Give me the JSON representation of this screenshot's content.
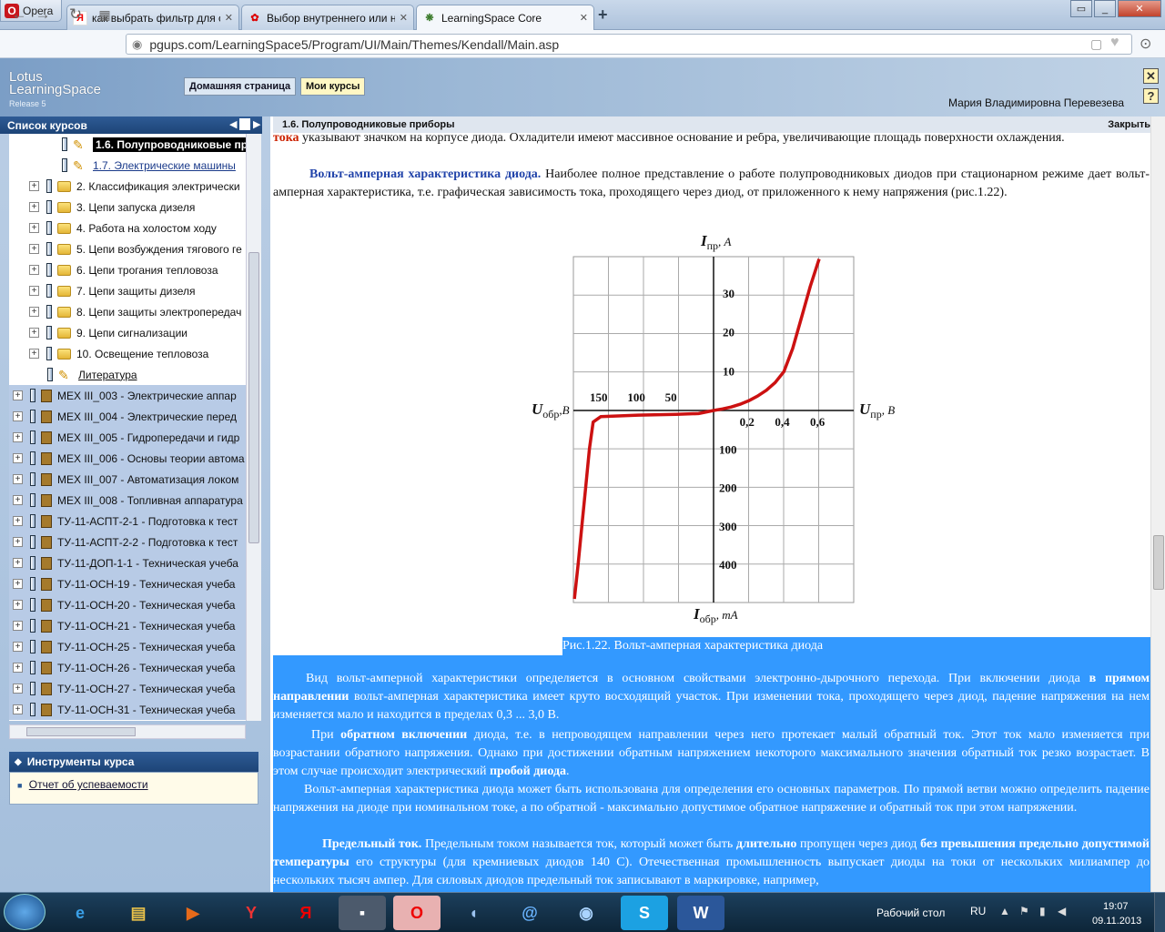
{
  "browser": {
    "opera_label": "Opera",
    "tabs": [
      {
        "title": "как выбрать фильтр для с",
        "icon": "yandex-icon"
      },
      {
        "title": "Выбор внутреннего или н",
        "icon": "aq-icon"
      },
      {
        "title": "LearningSpace Core",
        "icon": "lotus-icon"
      }
    ],
    "url": "pgups.com/LearningSpace5/Program/UI/Main/Themes/Kendall/Main.asp"
  },
  "lotus": {
    "logo_line1": "Lotus",
    "logo_line2": "LearningSpace",
    "release": "Release 5",
    "nav_home": "Домашняя страница",
    "nav_my_courses": "Мои курсы",
    "user_name": "Мария Владимировна Перевезева",
    "close_icon_label": "✕",
    "help_icon_label": "?"
  },
  "sidebar": {
    "header": "Список курсов",
    "tree": [
      {
        "label": "1.6. Полупроводниковые пр",
        "kind": "pencil",
        "selected": true
      },
      {
        "label": "1.7. Электрические машины",
        "kind": "pencil",
        "link": true
      },
      {
        "label": "2. Классификация электрически",
        "kind": "folder"
      },
      {
        "label": "3. Цепи запуска дизеля",
        "kind": "folder"
      },
      {
        "label": "4. Работа на холостом ходу",
        "kind": "folder"
      },
      {
        "label": "5. Цепи возбуждения тягового ге",
        "kind": "folder"
      },
      {
        "label": "6. Цепи трогания тепловоза",
        "kind": "folder"
      },
      {
        "label": "7. Цепи защиты дизеля",
        "kind": "folder"
      },
      {
        "label": "8. Цепи защиты электропередач",
        "kind": "folder"
      },
      {
        "label": "9. Цепи сигнализации",
        "kind": "folder"
      },
      {
        "label": "10. Освещение тепловоза",
        "kind": "folder"
      },
      {
        "label": "Литература",
        "kind": "pencil-link"
      },
      {
        "label": "МЕХ III_003 - Электрические аппар",
        "kind": "course"
      },
      {
        "label": "МЕХ III_004 - Электрические перед",
        "kind": "course"
      },
      {
        "label": "МЕХ III_005 - Гидропередачи и гидр",
        "kind": "course"
      },
      {
        "label": "МЕХ III_006 - Основы теории автома",
        "kind": "course"
      },
      {
        "label": "МЕХ III_007 - Автоматизация локом",
        "kind": "course"
      },
      {
        "label": "МЕХ III_008 - Топливная аппаратура",
        "kind": "course"
      },
      {
        "label": "ТУ-11-АСПТ-2-1 - Подготовка к тест",
        "kind": "course"
      },
      {
        "label": "ТУ-11-АСПТ-2-2 - Подготовка к тест",
        "kind": "course"
      },
      {
        "label": "ТУ-11-ДОП-1-1 - Техническая учеба",
        "kind": "course"
      },
      {
        "label": "ТУ-11-ОСН-19 - Техническая учеба",
        "kind": "course"
      },
      {
        "label": "ТУ-11-ОСН-20 - Техническая учеба",
        "kind": "course"
      },
      {
        "label": "ТУ-11-ОСН-21 - Техническая учеба",
        "kind": "course"
      },
      {
        "label": "ТУ-11-ОСН-25 - Техническая учеба",
        "kind": "course"
      },
      {
        "label": "ТУ-11-ОСН-26 - Техническая учеба",
        "kind": "course"
      },
      {
        "label": "ТУ-11-ОСН-27 - Техническая учеба",
        "kind": "course"
      },
      {
        "label": "ТУ-11-ОСН-31 - Техническая учеба",
        "kind": "course"
      }
    ],
    "tools_header": "Инструменты курса",
    "tools_link": "Отчет об успеваемости"
  },
  "content": {
    "header_title": "1.6. Полупроводниковые приборы",
    "close_label": "Закрыть",
    "p0_red": "тока",
    "p0_text": " указывают значком на корпусе диода. Охладители имеют массивное основание и ребра, увеличивающие площадь поверхности охлаждения.",
    "p1_head": "Вольт-амперная характеристика диода.",
    "p1_text": " Наиболее полное представление о работе полупроводниковых диодов при стационарном режиме дает вольт-амперная характеристика, т.е. графическая зависимость тока, проходящего через диод, от приложенного к нему напряжения (рис.1.22).",
    "caption": "Рис.1.22. Вольт-амперная характеристика диода",
    "p2_a": "Вид вольт-амперной характеристики определяется в основном свойствами электронно-дырочного перехода. При включении диода ",
    "p2_b": "в прямом направлении",
    "p2_c": " вольт-амперная характеристика имеет круто восходящий участок. При изменении тока, проходящего через диод, падение напряжения на нем изменяется мало и находится в пределах 0,3 ... 3,0 В.",
    "p3_a": "При ",
    "p3_b": "обратном включении",
    "p3_c": " диода, т.е. в непроводящем направлении через него протекает малый обратный ток. Этот ток мало изменяется при возрастании обратного напряжения. Однако при достижении обратным напряжением некоторого максимального значения обратный ток резко возрастает. В этом случае происходит электрический ",
    "p3_d": "пробой диода",
    "p3_e": ".",
    "p4": "Вольт-амперная характеристика диода может быть использована для определения его основных параметров. По прямой ветви можно определить падение напряжения на диоде при номинальном токе, а по обратной - максимально допустимое обратное напряжение и обратный ток при этом напряжении.",
    "p5_a": "Предельный ток.",
    "p5_b": " Предельным током называется ток, который может быть ",
    "p5_c": "длительно",
    "p5_d": " пропущен через диод ",
    "p5_e": "без превышения предельно допустимой температуры",
    "p5_f": " его структуры (для кремниевых диодов 140 С). Отечественная промышленность выпускает диоды на токи от нескольких милиампер до нескольких тысяч ампер. Для силовых диодов предельный ток записывают в маркировке, например,"
  },
  "chart_data": {
    "type": "line",
    "ylabel_forward": "I",
    "ylabel_forward_sub": "пр",
    "ylabel_forward_unit": ", A",
    "ylabel_reverse": "I",
    "ylabel_reverse_sub": "обр",
    "ylabel_reverse_unit": ", mA",
    "xlabel_forward": "U",
    "xlabel_forward_sub": "пр",
    "xlabel_forward_unit": ", В",
    "xlabel_reverse": "U",
    "xlabel_reverse_sub": "обр",
    "xlabel_reverse_unit": ",В",
    "x_forward_ticks": [
      "0,2",
      "0,4",
      "0,6"
    ],
    "x_reverse_ticks": [
      "150",
      "100",
      "50"
    ],
    "y_forward_ticks": [
      "10",
      "20",
      "30"
    ],
    "y_reverse_ticks": [
      "100",
      "200",
      "300",
      "400"
    ],
    "forward_branch": [
      [
        0,
        0
      ],
      [
        0.05,
        0.4
      ],
      [
        0.1,
        0.9
      ],
      [
        0.15,
        1.6
      ],
      [
        0.2,
        2.5
      ],
      [
        0.25,
        3.7
      ],
      [
        0.3,
        5.2
      ],
      [
        0.35,
        7.2
      ],
      [
        0.4,
        10
      ],
      [
        0.45,
        16
      ],
      [
        0.5,
        24
      ],
      [
        0.55,
        32
      ],
      [
        0.6,
        39
      ]
    ],
    "reverse_branch": [
      [
        0,
        0
      ],
      [
        -20,
        -8
      ],
      [
        -50,
        -10
      ],
      [
        -100,
        -12
      ],
      [
        -150,
        -16
      ],
      [
        -160,
        -30
      ],
      [
        -165,
        -100
      ],
      [
        -170,
        -200
      ],
      [
        -175,
        -300
      ],
      [
        -180,
        -400
      ],
      [
        -185,
        -490
      ]
    ],
    "curve_color": "#cc1111",
    "grid": true
  },
  "taskbar": {
    "desktop_label": "Рабочий стол",
    "lang": "RU",
    "time": "19:07",
    "date": "09.11.2013"
  }
}
